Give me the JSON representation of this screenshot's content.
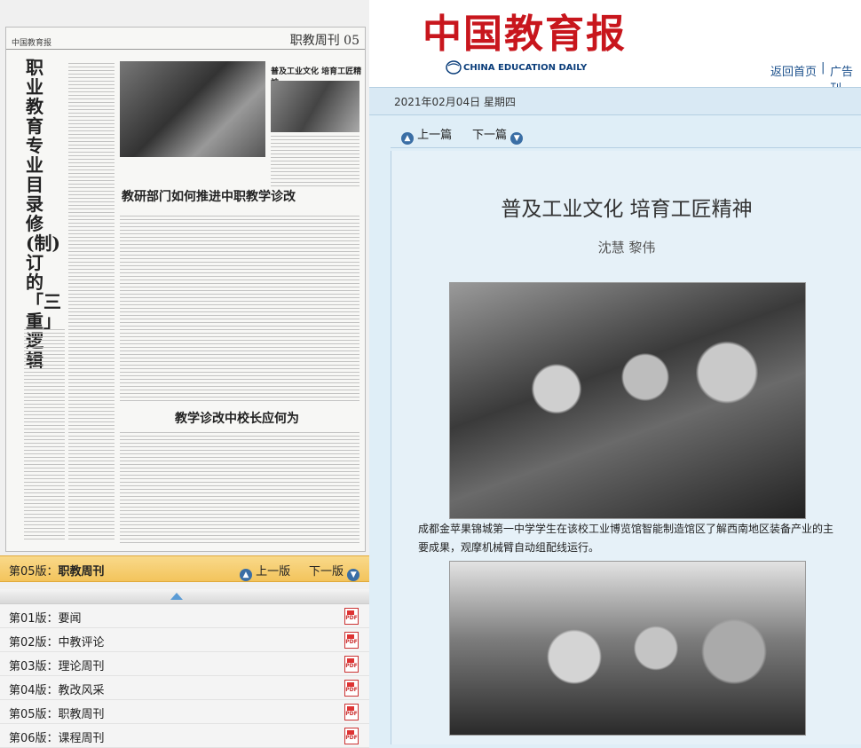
{
  "header": {
    "logo_cn": "中国教育报",
    "logo_en": "CHINA EDUCATION DAILY",
    "home_link": "返回首页",
    "separator": "|",
    "ad_link": "广告刊"
  },
  "dateline": "2021年02月04日 星期四",
  "nav": {
    "prev": "上一篇",
    "next": "下一篇"
  },
  "article": {
    "title": "普及工业文化  培育工匠精神",
    "authors": "沈慧  黎伟",
    "caption": "成都金苹果锦城第一中学学生在该校工业博览馆智能制造馆区了解西南地区装备产业的主要成果，观摩机械臂自动组配线运行。"
  },
  "paper": {
    "section": "职教周刊 05",
    "logo": "中国教育报",
    "vertical_title": "职业教育专业目录修(制)订的「三重」逻辑",
    "headline_top_right": "普及工业文化  培育工匠精神",
    "headline_mid": "教研部门如何推进中职教学诊改",
    "headline_bottom": "教学诊改中校长应何为"
  },
  "page_bar": {
    "current_prefix": "第05版：",
    "current_name": "职教周刊",
    "prev": "上一版",
    "next": "下一版"
  },
  "editions": [
    {
      "label": "第01版：要闻"
    },
    {
      "label": "第02版：中教评论"
    },
    {
      "label": "第03版：理论周刊"
    },
    {
      "label": "第04版：教改风采"
    },
    {
      "label": "第05版：职教周刊"
    },
    {
      "label": "第06版：课程周刊"
    }
  ],
  "colors": {
    "brand_red": "#c8161d",
    "link_blue": "#1a4f8b",
    "page_bar": "#f3c45c"
  }
}
